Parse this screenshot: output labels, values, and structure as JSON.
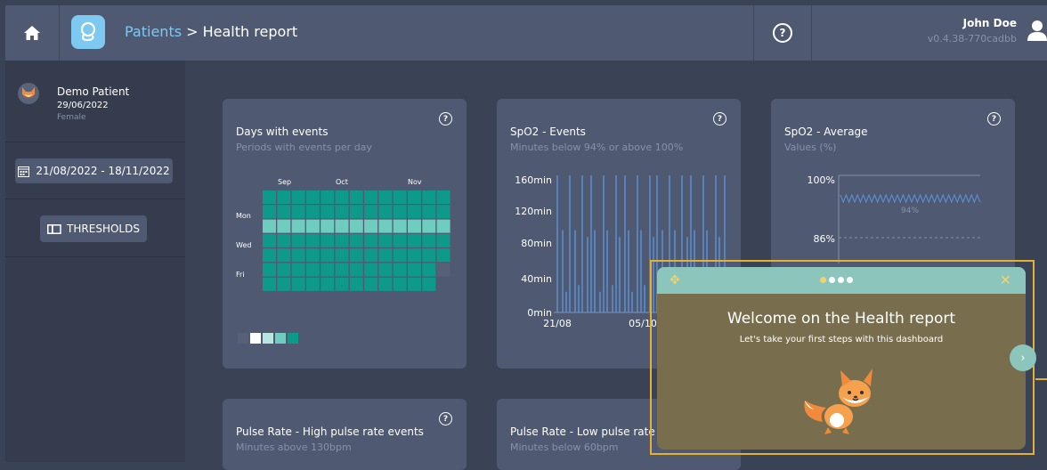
{
  "header": {
    "breadcrumb_link": "Patients",
    "breadcrumb_sep": " > ",
    "breadcrumb_current": "Health report",
    "user_name": "John Doe",
    "version": "v0.4.38-770cadbb"
  },
  "sidebar": {
    "patient_name": "Demo Patient",
    "patient_date": "29/06/2022",
    "patient_sex": "Female",
    "date_range": "21/08/2022 - 18/11/2022",
    "thresholds_label": "THRESHOLDS"
  },
  "cards": {
    "days_events": {
      "title": "Days with events",
      "subtitle": "Periods with events per day",
      "months": [
        "Sep",
        "Oct",
        "Nov"
      ],
      "days": [
        "Mon",
        "Wed",
        "Fri"
      ]
    },
    "spo2_events": {
      "title": "SpO2 - Events",
      "subtitle": "Minutes below 94% or above 100%",
      "yticks": [
        "160min",
        "120min",
        "80min",
        "40min",
        "0min"
      ],
      "xticks": [
        "21/08",
        "05/10"
      ]
    },
    "spo2_average": {
      "title": "SpO2 - Average",
      "subtitle": "Values (%)",
      "yticks": [
        "100%",
        "86%"
      ],
      "avg_label": "94%"
    },
    "pulse_high": {
      "title": "Pulse Rate - High pulse rate events",
      "subtitle": "Minutes above 130bpm"
    },
    "pulse_low": {
      "title": "Pulse Rate - Low pulse rate eve",
      "subtitle": "Minutes below 60bpm"
    }
  },
  "tour": {
    "title": "Welcome on the Health report",
    "subtitle": "Let's take your first steps with this dashboard",
    "step": 1,
    "steps": 4
  },
  "colors": {
    "accent": "#7ec9f2",
    "teal": "#0e9a8b",
    "teal_light": "#6fcdc0",
    "highlight": "#e6b12e",
    "bar": "#5b93d8"
  }
}
